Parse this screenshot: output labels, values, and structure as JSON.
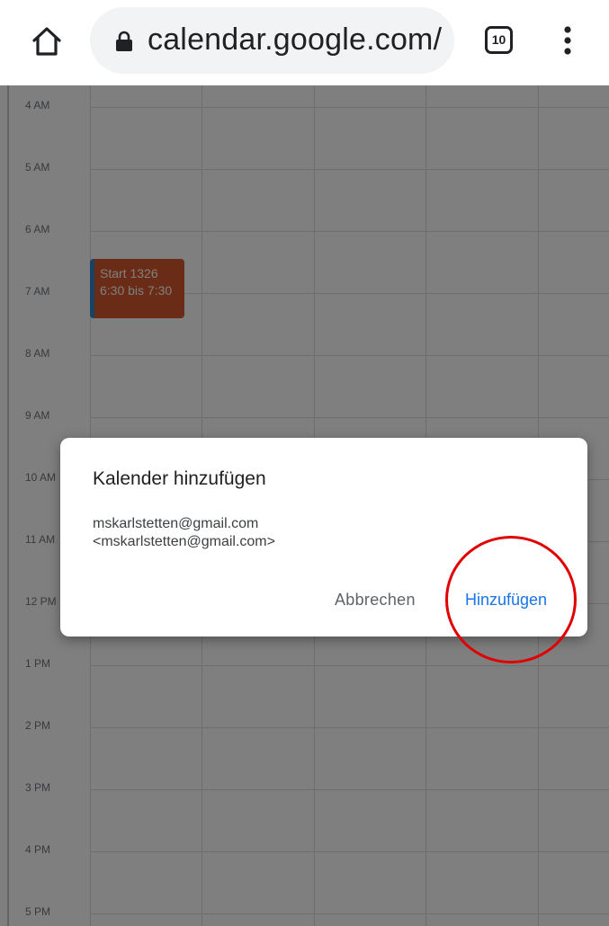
{
  "browser": {
    "url": "calendar.google.com/",
    "tab_count": "10"
  },
  "calendar": {
    "time_labels": [
      "4 AM",
      "5 AM",
      "6 AM",
      "7 AM",
      "8 AM",
      "9 AM",
      "10 AM",
      "11 AM",
      "12 PM",
      "1 PM",
      "2 PM",
      "3 PM",
      "4 PM",
      "5 PM"
    ],
    "event": {
      "title": "Start 1326",
      "time": "6:30 bis 7:30"
    },
    "colors": {
      "event": "#d5592f",
      "event_accent": "#2f89c9"
    }
  },
  "dialog": {
    "title": "Kalender hinzufügen",
    "line1": "mskarlstetten@gmail.com",
    "line2": "<mskarlstetten@gmail.com>",
    "cancel_label": "Abbrechen",
    "add_label": "Hinzufügen"
  },
  "colors": {
    "primary_button": "#1a73e8",
    "highlight": "#e00000"
  }
}
